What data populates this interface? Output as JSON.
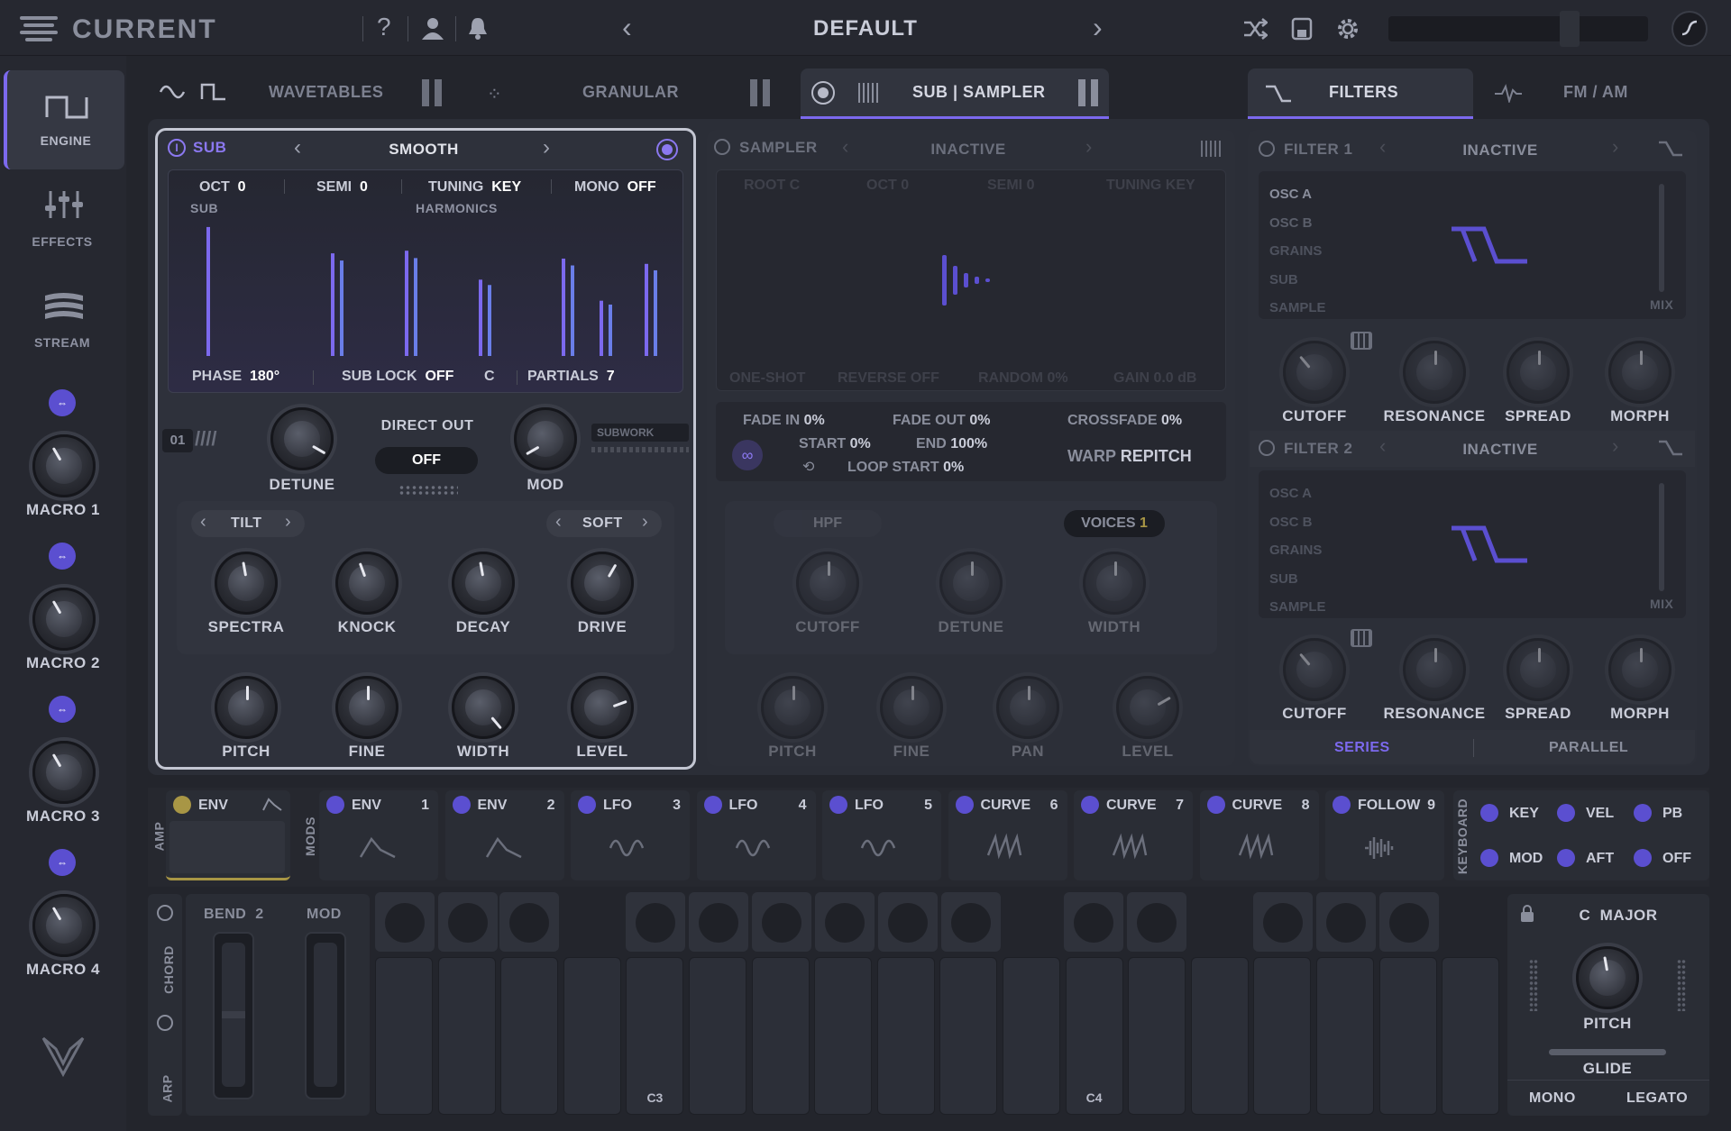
{
  "app": {
    "name": "CURRENT",
    "preset": "DEFAULT"
  },
  "header": {
    "help": "?",
    "prev": "‹",
    "next": "›"
  },
  "sidebar": {
    "items": [
      {
        "label": "ENGINE"
      },
      {
        "label": "EFFECTS"
      },
      {
        "label": "STREAM"
      }
    ],
    "macros": [
      "MACRO 1",
      "MACRO 2",
      "MACRO 3",
      "MACRO 4"
    ]
  },
  "tabs": {
    "wavetables": "WAVETABLES",
    "granular": "GRANULAR",
    "sub_sampler": "SUB | SAMPLER",
    "filters": "FILTERS",
    "fm_am": "FM / AM"
  },
  "sub": {
    "title": "SUB",
    "preset": "SMOOTH",
    "params": [
      {
        "k": "OCT",
        "v": "0"
      },
      {
        "k": "SEMI",
        "v": "0"
      },
      {
        "k": "TUNING",
        "v": "KEY"
      },
      {
        "k": "MONO",
        "v": "OFF"
      }
    ],
    "graph_left": "SUB",
    "graph_center": "HARMONICS",
    "bottom": [
      {
        "k": "PHASE",
        "v": "180°"
      },
      {
        "k": "SUB LOCK",
        "v": "OFF",
        "v2": "C"
      },
      {
        "k": "PARTIALS",
        "v": "7"
      }
    ],
    "harmonic_levels": [
      0.98,
      0.78,
      0.8,
      0.58,
      0.74,
      0.42,
      0.7
    ],
    "slot": "01",
    "subwork": "SUBWORK",
    "detune": "DETUNE",
    "direct_out": "DIRECT OUT",
    "direct_value": "OFF",
    "mod": "MOD",
    "tilt": "TILT",
    "soft": "SOFT",
    "knobs1": [
      "SPECTRA",
      "KNOCK",
      "DECAY",
      "DRIVE"
    ],
    "knobs2": [
      "PITCH",
      "FINE",
      "WIDTH",
      "LEVEL"
    ]
  },
  "sampler": {
    "title": "SAMPLER",
    "state": "INACTIVE",
    "params": [
      {
        "k": "ROOT",
        "v": "C"
      },
      {
        "k": "OCT",
        "v": "0"
      },
      {
        "k": "SEMI",
        "v": "0"
      },
      {
        "k": "TUNING",
        "v": "KEY"
      }
    ],
    "bottom": [
      {
        "k": "ONE-SHOT",
        "v": ""
      },
      {
        "k": "REVERSE",
        "v": "OFF"
      },
      {
        "k": "RANDOM",
        "v": "0%"
      },
      {
        "k": "GAIN",
        "v": "0.0 dB"
      }
    ],
    "fade_in": {
      "k": "FADE IN",
      "v": "0%"
    },
    "fade_out": {
      "k": "FADE OUT",
      "v": "0%"
    },
    "crossfade": {
      "k": "CROSSFADE",
      "v": "0%"
    },
    "start": {
      "k": "START",
      "v": "0%"
    },
    "end": {
      "k": "END",
      "v": "100%"
    },
    "loop_start": {
      "k": "LOOP START",
      "v": "0%"
    },
    "warp": {
      "k": "WARP",
      "v": "REPITCH"
    },
    "hpf": "HPF",
    "voices": {
      "k": "VOICES",
      "v": "1"
    },
    "knobs1": [
      "CUTOFF",
      "DETUNE",
      "WIDTH"
    ],
    "knobs2": [
      "PITCH",
      "FINE",
      "PAN",
      "LEVEL"
    ]
  },
  "filters": [
    {
      "title": "FILTER 1",
      "state": "INACTIVE",
      "sources": [
        "OSC A",
        "OSC B",
        "GRAINS",
        "SUB",
        "SAMPLE"
      ],
      "mix": "MIX",
      "knobs": [
        "CUTOFF",
        "RESONANCE",
        "SPREAD",
        "MORPH"
      ]
    },
    {
      "title": "FILTER 2",
      "state": "INACTIVE",
      "sources": [
        "OSC A",
        "OSC B",
        "GRAINS",
        "SUB",
        "SAMPLE"
      ],
      "mix": "MIX",
      "knobs": [
        "CUTOFF",
        "RESONANCE",
        "SPREAD",
        "MORPH"
      ]
    }
  ],
  "routing": {
    "series": "SERIES",
    "parallel": "PARALLEL"
  },
  "mods": {
    "amp": "AMP",
    "mods": "MODS",
    "amp_env": "ENV",
    "slots": [
      {
        "t": "ENV",
        "n": "1"
      },
      {
        "t": "ENV",
        "n": "2"
      },
      {
        "t": "LFO",
        "n": "3"
      },
      {
        "t": "LFO",
        "n": "4"
      },
      {
        "t": "LFO",
        "n": "5"
      },
      {
        "t": "CURVE",
        "n": "6"
      },
      {
        "t": "CURVE",
        "n": "7"
      },
      {
        "t": "CURVE",
        "n": "8"
      },
      {
        "t": "FOLLOW",
        "n": "9"
      }
    ],
    "keyboard": "KEYBOARD",
    "kb": [
      "KEY",
      "VEL",
      "PB",
      "MOD",
      "AFT",
      "OFF"
    ]
  },
  "perf": {
    "bend": "BEND",
    "bend_val": "2",
    "mod": "MOD",
    "chord": "CHORD",
    "arp": "ARP",
    "c3": "C3",
    "c4": "C4",
    "scale": "C  MAJOR",
    "pitch": "PITCH",
    "glide": "GLIDE",
    "mono": "MONO",
    "legato": "LEGATO"
  },
  "colors": {
    "accent": "#7c69ee",
    "bg": "#23252c",
    "panel": "#2c2f38"
  }
}
